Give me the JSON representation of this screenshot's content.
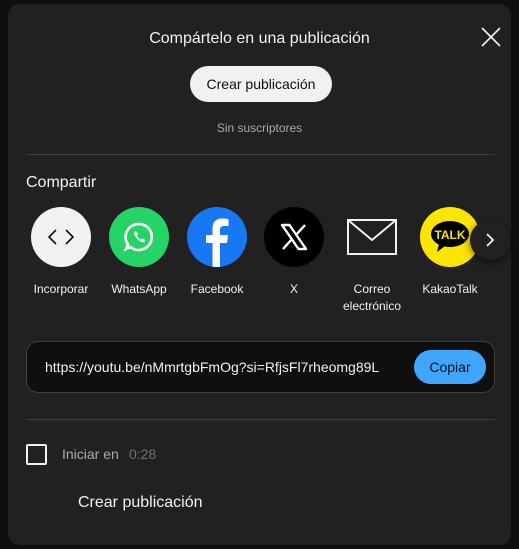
{
  "dialog": {
    "title": "Compártelo en una publicación",
    "create_post_label": "Crear publicación",
    "subscribers_text": "Sin suscriptores",
    "share_heading": "Compartir",
    "share_targets": [
      {
        "label": "Incorporar",
        "icon": "embed-icon",
        "color": "#f1f1f1"
      },
      {
        "label": "WhatsApp",
        "icon": "whatsapp-icon",
        "color": "#25d366"
      },
      {
        "label": "Facebook",
        "icon": "facebook-icon",
        "color": "#1877f2"
      },
      {
        "label": "X",
        "icon": "x-icon",
        "color": "#000000"
      },
      {
        "label": "Correo electrónico",
        "icon": "email-icon",
        "color": "#212121"
      },
      {
        "label": "KakaoTalk",
        "icon": "kakaotalk-icon",
        "color": "#fee500",
        "icon_text": "TALK"
      }
    ],
    "url": "https://youtu.be/nMmrtgbFmOg?si=RfjsFl7rheomg89L",
    "copy_label": "Copiar",
    "start_at_label": "Iniciar en",
    "start_at_time": "0:28",
    "bottom_create_label": "Crear publicación"
  },
  "colors": {
    "dialog_bg": "#212121",
    "accent": "#3ea6ff"
  }
}
